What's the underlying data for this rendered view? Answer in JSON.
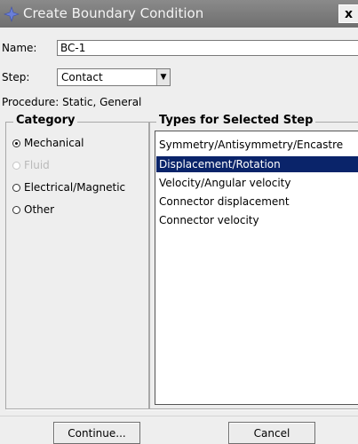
{
  "window": {
    "title": "Create Boundary Condition",
    "close_label": "x"
  },
  "form": {
    "name_label": "Name:",
    "name_value": "BC-1",
    "step_label": "Step:",
    "step_value": "Contact",
    "procedure_text": "Procedure:  Static, General"
  },
  "category": {
    "title": "Category",
    "options": [
      {
        "label": "Mechanical",
        "selected": true,
        "enabled": true
      },
      {
        "label": "Fluid",
        "selected": false,
        "enabled": false
      },
      {
        "label": "Electrical/Magnetic",
        "selected": false,
        "enabled": true
      },
      {
        "label": "Other",
        "selected": false,
        "enabled": true
      }
    ]
  },
  "types": {
    "title": "Types for Selected Step",
    "items": [
      {
        "label": "Symmetry/Antisymmetry/Encastre",
        "selected": false
      },
      {
        "label": "Displacement/Rotation",
        "selected": true
      },
      {
        "label": "Velocity/Angular velocity",
        "selected": false
      },
      {
        "label": "Connector displacement",
        "selected": false
      },
      {
        "label": "Connector velocity",
        "selected": false
      }
    ]
  },
  "buttons": {
    "continue_label": "Continue...",
    "cancel_label": "Cancel"
  },
  "colors": {
    "selection": "#0a246a",
    "titlebar": "#7d7d7d",
    "app_icon": "#6a7fd8"
  }
}
